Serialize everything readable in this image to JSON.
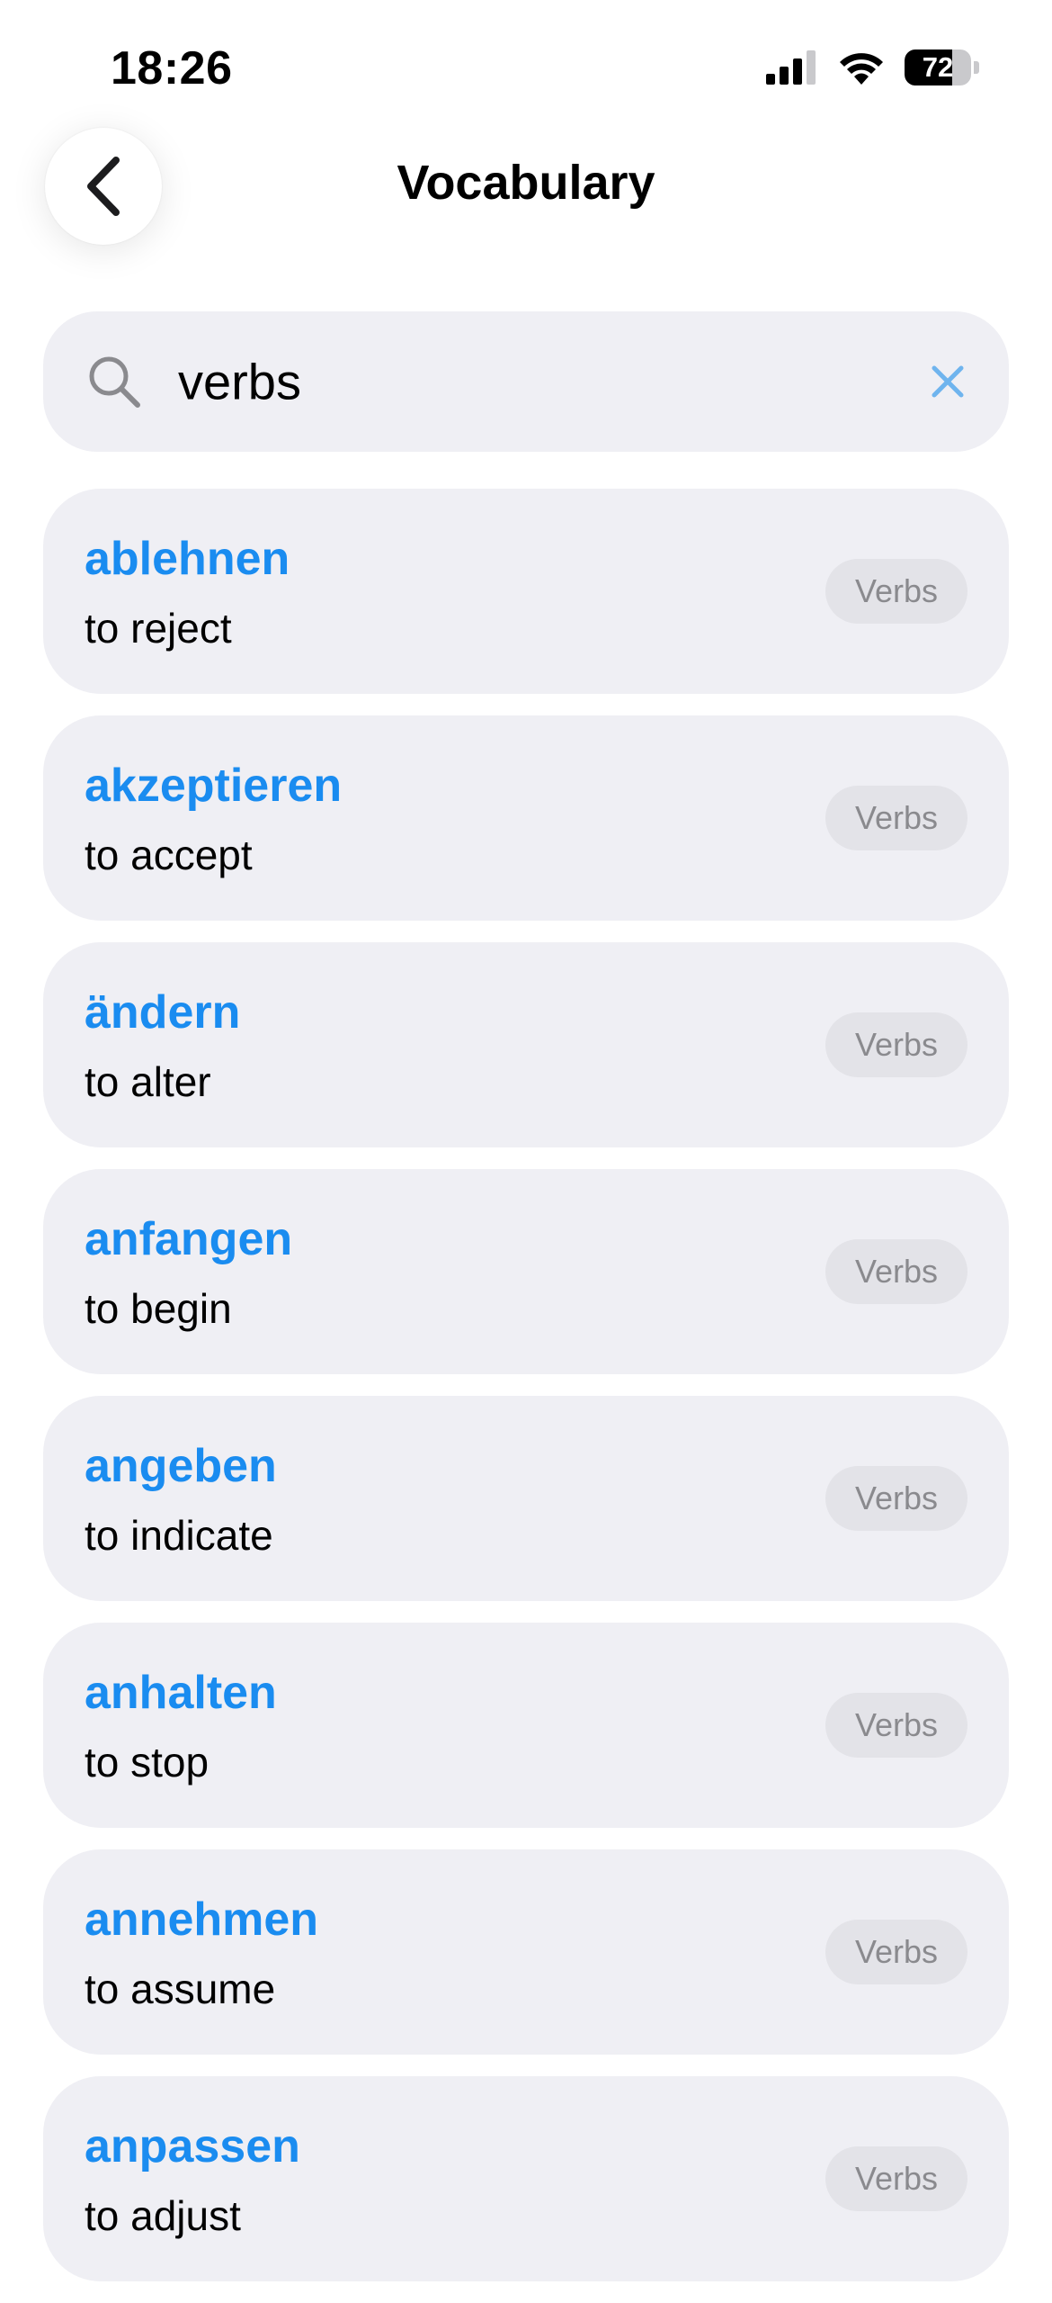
{
  "status_bar": {
    "time": "18:26",
    "battery_level": "72",
    "battery_percent": 72
  },
  "header": {
    "title": "Vocabulary",
    "back_icon": "chevron-left-icon"
  },
  "search": {
    "value": "verbs",
    "search_icon": "magnifying-glass-icon",
    "clear_icon": "x-mark-icon"
  },
  "colors": {
    "accent": "#1a8cf0",
    "card_background": "#efeff4",
    "badge_background": "#e3e3e8",
    "badge_text": "#8a8a8e"
  },
  "vocabulary": [
    {
      "word": "ablehnen",
      "translation": "to reject",
      "category": "Verbs"
    },
    {
      "word": "akzeptieren",
      "translation": "to accept",
      "category": "Verbs"
    },
    {
      "word": "ändern",
      "translation": "to alter",
      "category": "Verbs"
    },
    {
      "word": "anfangen",
      "translation": "to begin",
      "category": "Verbs"
    },
    {
      "word": "angeben",
      "translation": "to indicate",
      "category": "Verbs"
    },
    {
      "word": "anhalten",
      "translation": "to stop",
      "category": "Verbs"
    },
    {
      "word": "annehmen",
      "translation": "to assume",
      "category": "Verbs"
    },
    {
      "word": "anpassen",
      "translation": "to adjust",
      "category": "Verbs"
    }
  ]
}
